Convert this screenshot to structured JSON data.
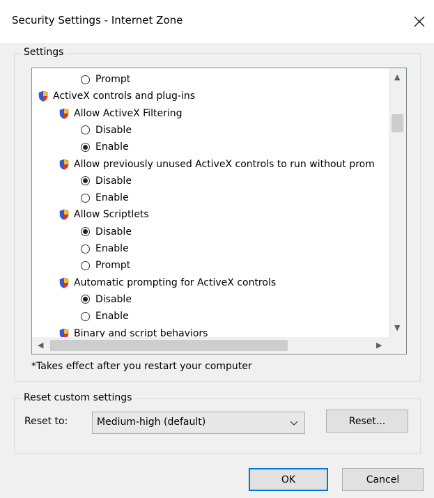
{
  "window": {
    "title": "Security Settings - Internet Zone",
    "close_glyph": "✕"
  },
  "settings_group": {
    "legend": "Settings",
    "items": [
      {
        "kind": "radio",
        "label": "Prompt",
        "checked": false
      },
      {
        "kind": "category",
        "label": "ActiveX controls and plug-ins"
      },
      {
        "kind": "setting",
        "label": "Allow ActiveX Filtering"
      },
      {
        "kind": "radio",
        "label": "Disable",
        "checked": false
      },
      {
        "kind": "radio",
        "label": "Enable",
        "checked": true
      },
      {
        "kind": "setting",
        "label": "Allow previously unused ActiveX controls to run without prom"
      },
      {
        "kind": "radio",
        "label": "Disable",
        "checked": true
      },
      {
        "kind": "radio",
        "label": "Enable",
        "checked": false
      },
      {
        "kind": "setting",
        "label": "Allow Scriptlets"
      },
      {
        "kind": "radio",
        "label": "Disable",
        "checked": true
      },
      {
        "kind": "radio",
        "label": "Enable",
        "checked": false
      },
      {
        "kind": "radio",
        "label": "Prompt",
        "checked": false
      },
      {
        "kind": "setting",
        "label": "Automatic prompting for ActiveX controls"
      },
      {
        "kind": "radio",
        "label": "Disable",
        "checked": true
      },
      {
        "kind": "radio",
        "label": "Enable",
        "checked": false
      },
      {
        "kind": "setting",
        "label": "Binary and script behaviors"
      }
    ],
    "note": "*Takes effect after you restart your computer"
  },
  "reset_group": {
    "legend": "Reset custom settings",
    "reset_to_label": "Reset to:",
    "selected_level": "Medium-high (default)",
    "reset_button": "Reset..."
  },
  "footer": {
    "ok_label": "OK",
    "cancel_label": "Cancel"
  },
  "icons": {
    "close": "close-icon",
    "shield": "shield-icon",
    "chevron": "chevron-down-icon"
  },
  "colors": {
    "dialog_bg": "#f0f0f0",
    "default_button_border": "#0078d7"
  }
}
